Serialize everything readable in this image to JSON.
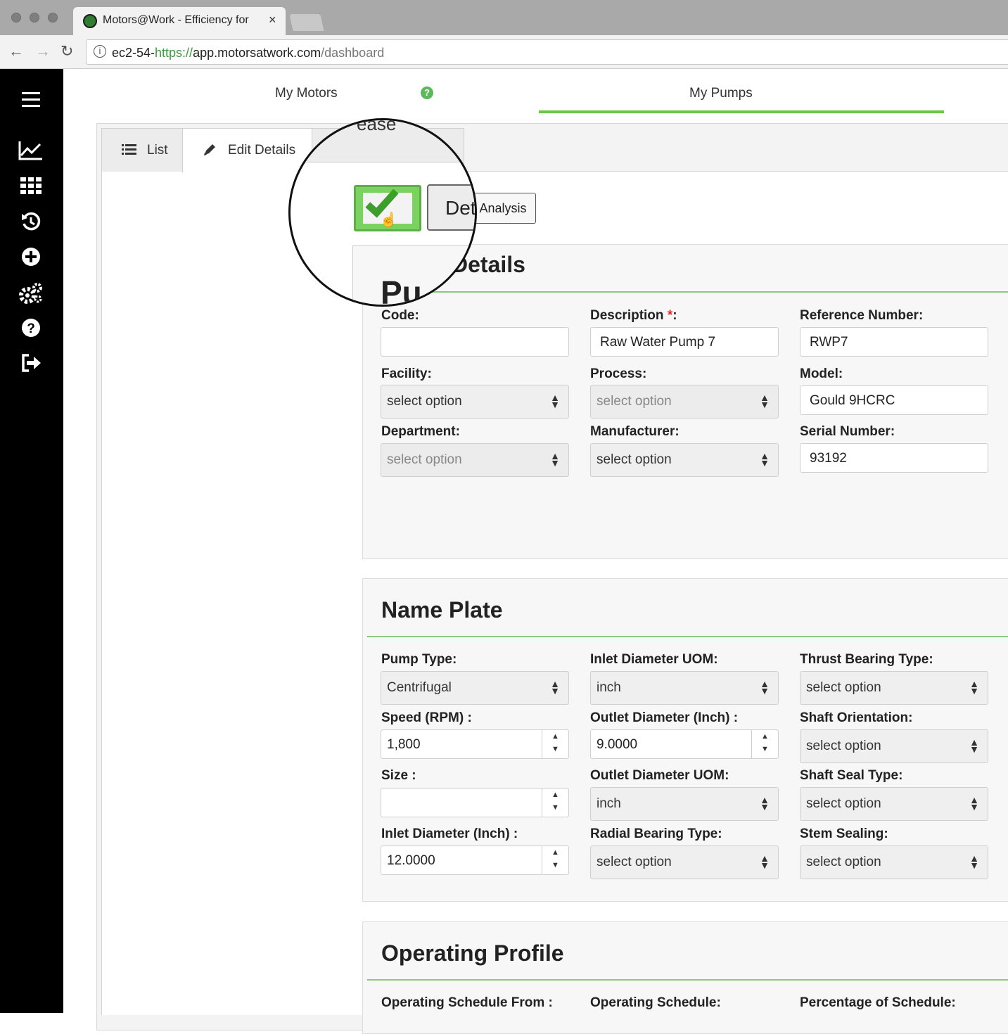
{
  "browser": {
    "tab_title": "Motors@Work - Efficiency for",
    "close_glyph": "×",
    "url_prefix": "ec2-54-",
    "url_scheme": "https://",
    "url_host": "app.motorsatwork.com",
    "url_path": "/dashboard"
  },
  "sidebar": {
    "items": [
      "menu-icon",
      "chart-icon",
      "grid-icon",
      "history-icon",
      "add-icon",
      "settings-icon",
      "help-icon",
      "logout-icon"
    ]
  },
  "topnav": {
    "motors": "My Motors",
    "pumps": "My Pumps",
    "help_glyph": "?"
  },
  "tabs": {
    "list": "List",
    "edit": "Edit Details"
  },
  "toolbar": {
    "analysis_label": "Analysis",
    "magnified_button": "Det",
    "magnified_tab": "ease"
  },
  "pump_details": {
    "title": "Details",
    "magnified_title": "Pu",
    "fields": {
      "code_label": "Code:",
      "code_value": "",
      "description_label": "Description ",
      "description_req": "*",
      "description_suffix": ":",
      "description_value": "Raw Water Pump 7",
      "reference_label": "Reference Number:",
      "reference_value": "RWP7",
      "facility_label": "Facility:",
      "facility_value": "select option",
      "process_label": "Process:",
      "process_value": "select option",
      "model_label": "Model:",
      "model_value": "Gould 9HCRC",
      "department_label": "Department:",
      "department_value": "select option",
      "manufacturer_label": "Manufacturer:",
      "manufacturer_value": "select option",
      "serial_label": "Serial Number:",
      "serial_value": "93192"
    }
  },
  "name_plate": {
    "title": "Name Plate",
    "pump_type_label": "Pump Type:",
    "pump_type_value": "Centrifugal",
    "inlet_uom_label": "Inlet Diameter UOM:",
    "inlet_uom_value": "inch",
    "thrust_label": "Thrust Bearing Type:",
    "thrust_value": "select option",
    "speed_label": "Speed (RPM) :",
    "speed_value": "1,800",
    "outlet_diam_label": "Outlet Diameter (Inch) :",
    "outlet_diam_value": "9.0000",
    "shaft_orient_label": "Shaft Orientation:",
    "shaft_orient_value": "select option",
    "size_label": "Size :",
    "size_value": "",
    "outlet_uom_label": "Outlet Diameter UOM:",
    "outlet_uom_value": "inch",
    "shaft_seal_label": "Shaft Seal Type:",
    "shaft_seal_value": "select option",
    "inlet_diam_label": "Inlet Diameter (Inch) :",
    "inlet_diam_value": "12.0000",
    "radial_label": "Radial Bearing Type:",
    "radial_value": "select option",
    "stem_label": "Stem Sealing:",
    "stem_value": "select option"
  },
  "operating_profile": {
    "title": "Operating Profile",
    "schedule_from_label": "Operating Schedule From :",
    "schedule_label": "Operating Schedule:",
    "percentage_label": "Percentage of Schedule:"
  },
  "colors": {
    "accent_green": "#6cc644",
    "sidebar_bg": "#000000",
    "required_red": "#d9302c"
  }
}
